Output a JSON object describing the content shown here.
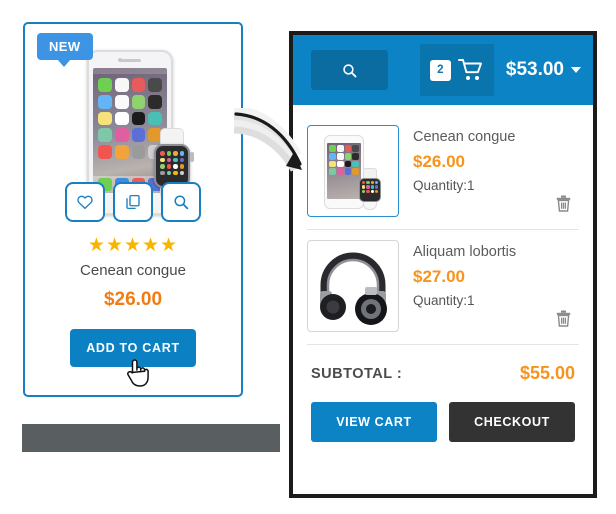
{
  "product_card": {
    "badge": "NEW",
    "image_alt": "smartphone-and-smartwatch",
    "actions": [
      {
        "name": "wishlist",
        "icon": "heart-icon"
      },
      {
        "name": "compare",
        "icon": "copy-icon"
      },
      {
        "name": "quick-view",
        "icon": "search-icon"
      }
    ],
    "rating_stars": "★★★★★",
    "rating_value": 5,
    "title": "Cenean congue",
    "price": "$26.00",
    "add_to_cart_label": "ADD TO CART",
    "cursor": "pointing-hand"
  },
  "gray_bar": {
    "label": ""
  },
  "annotation": {
    "arrow": "curved-arrow-pointing-to-cart"
  },
  "cart": {
    "header": {
      "search_icon": "search-icon",
      "search_placeholder": "",
      "cart_icon": "shopping-cart-icon",
      "item_count": "2",
      "total": "$53.00",
      "caret": "chevron-down-icon"
    },
    "items": [
      {
        "name": "Cenean congue",
        "price": "$26.00",
        "quantity_label": "Quantity:1",
        "thumb": "smartphone-and-smartwatch",
        "remove_icon": "trash-icon",
        "highlighted": true
      },
      {
        "name": "Aliquam lobortis",
        "price": "$27.00",
        "quantity_label": "Quantity:1",
        "thumb": "headphones",
        "remove_icon": "trash-icon",
        "highlighted": false
      }
    ],
    "subtotal_label": "SUBTOTAL :",
    "subtotal_value": "$55.00",
    "view_cart_label": "VIEW CART",
    "checkout_label": "CHECKOUT"
  },
  "colors": {
    "primary_blue": "#0b83c4",
    "card_border_blue": "#1a7fc1",
    "badge_blue": "#3d94e5",
    "price_orange": "#f7941d",
    "star_gold": "#f8b500",
    "checkout_dark": "#333333",
    "gray_bar": "#595e60"
  }
}
